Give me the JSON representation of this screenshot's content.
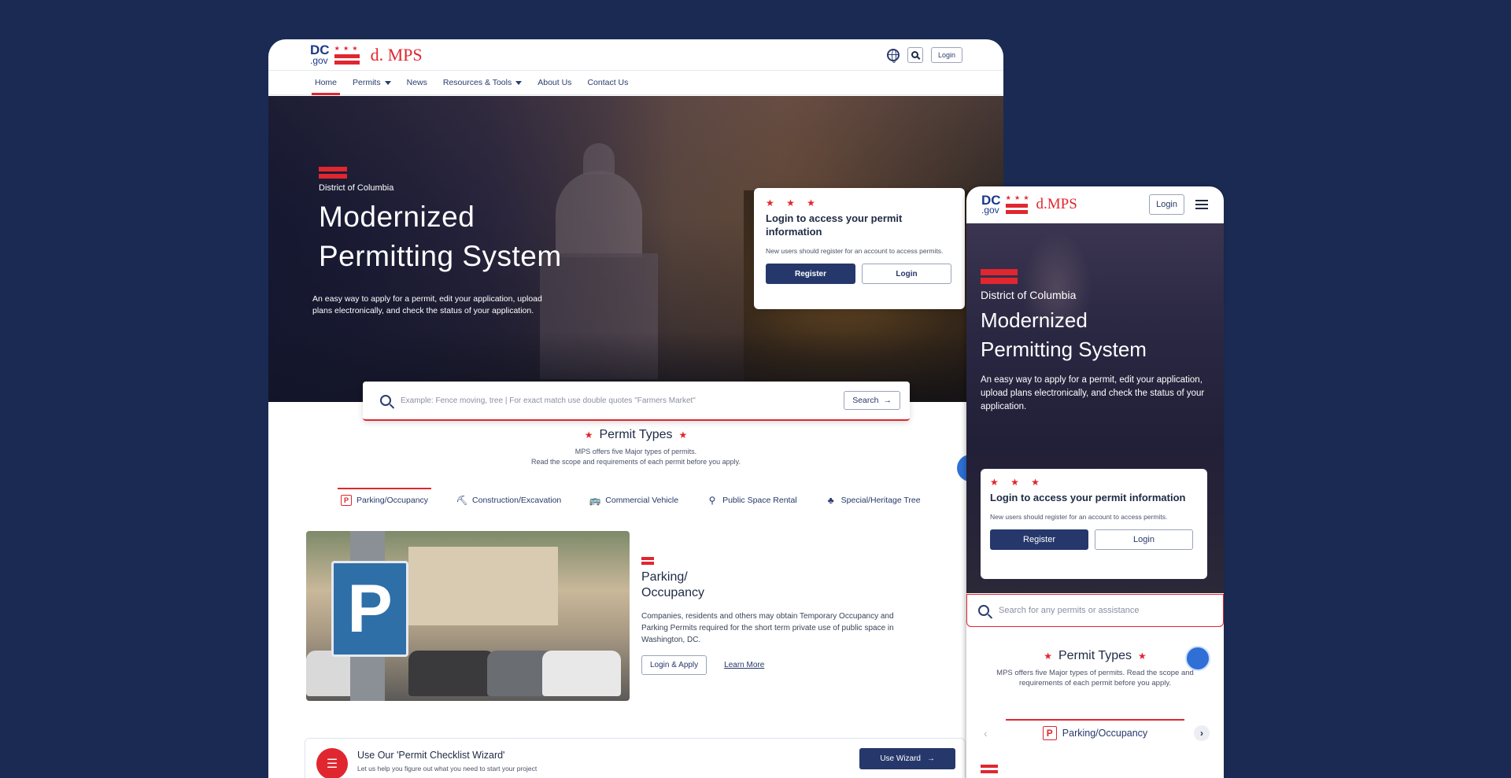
{
  "brand": {
    "dc": "DC",
    "gov": ".gov",
    "mps": "d. MPS",
    "mps_mobile": "d.MPS",
    "stars": "★ ★ ★"
  },
  "desktop": {
    "header": {
      "login": "Login"
    },
    "nav": [
      {
        "label": "Home"
      },
      {
        "label": "Permits"
      },
      {
        "label": "News"
      },
      {
        "label": "Resources & Tools"
      },
      {
        "label": "About Us"
      },
      {
        "label": "Contact Us"
      }
    ],
    "hero": {
      "eyebrow": "District of Columbia",
      "title_line1": "Modernized",
      "title_line2": "Permitting System",
      "description": "An easy way to apply for a permit, edit your application, upload plans electronically, and check the status of your application."
    },
    "login_card": {
      "stars": "★ ★ ★",
      "title": "Login to access your permit information",
      "subtitle": "New users should register for an account to access permits.",
      "register": "Register",
      "login": "Login"
    },
    "search": {
      "placeholder": "Example: Fence moving, tree | For exact match use double quotes \"Farmers Market\"",
      "button": "Search",
      "arrow": "→"
    },
    "permit_types": {
      "title": "Permit Types",
      "line1": "MPS offers five Major types of permits.",
      "line2": "Read the scope and requirements of each permit before you apply.",
      "tabs": [
        {
          "label": "Parking/Occupancy",
          "icon": "P"
        },
        {
          "label": "Construction/Excavation",
          "icon": "⛏"
        },
        {
          "label": "Commercial Vehicle",
          "icon": "🚌"
        },
        {
          "label": "Public Space Rental",
          "icon": "⚲"
        },
        {
          "label": "Special/Heritage Tree",
          "icon": "♣"
        }
      ]
    },
    "featured": {
      "image_sign": "P",
      "title": "Parking/ Occupancy",
      "description": "Companies, residents and others may obtain Temporary Occupancy and Parking Permits required for the short term private use of public space in Washington, DC.",
      "apply": "Login & Apply",
      "learn": "Learn More"
    },
    "wizard": {
      "title": "Use Our 'Permit Checklist Wizard'",
      "subtitle": "Let us help you figure out what you need to start your project",
      "button": "Use Wizard",
      "arrow": "→"
    }
  },
  "mobile": {
    "login": "Login",
    "hero": {
      "eyebrow": "District of Columbia",
      "title_line1": "Modernized",
      "title_line2": "Permitting System",
      "description": "An easy way to apply for a permit, edit your application, upload plans electronically, and check the status of your application."
    },
    "login_card": {
      "stars": "★ ★ ★",
      "title": "Login to access your permit information",
      "subtitle": "New users should register for an account to access permits.",
      "register": "Register",
      "login": "Login"
    },
    "search_placeholder": "Search for any permits or assistance",
    "permit_types": {
      "title": "Permit Types",
      "subtitle": "MPS offers five Major types of permits. Read the scope and requirements of each permit before you apply."
    },
    "active_tab": {
      "label": "Parking/Occupancy",
      "icon": "P"
    },
    "chev_left": "‹",
    "chev_right": "›"
  },
  "colors": {
    "background": "#1a2a52",
    "accent": "#e0262f",
    "primary": "#26386b"
  }
}
